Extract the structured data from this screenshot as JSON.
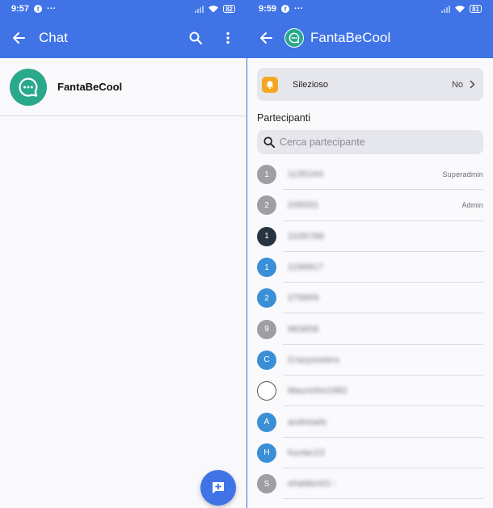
{
  "left": {
    "status": {
      "time": "9:57",
      "dots": "···",
      "battery": "82"
    },
    "header": {
      "title": "Chat"
    },
    "chats": [
      {
        "name": "FantaBeCool"
      }
    ]
  },
  "right": {
    "status": {
      "time": "9:59",
      "dots": "···",
      "battery": "81"
    },
    "header": {
      "title": "FantaBeCool"
    },
    "silent": {
      "label": "Silezioso",
      "value": "No"
    },
    "participants_title": "Partecipanti",
    "search": {
      "placeholder": "Cerca partecipante",
      "value": ""
    },
    "participants": [
      {
        "initial": "1",
        "name": "1135244",
        "role": "Superadmin",
        "color": "#9e9ea3",
        "outline": false
      },
      {
        "initial": "2",
        "name": "249331",
        "role": "Admin",
        "color": "#9e9ea3",
        "outline": false
      },
      {
        "initial": "1",
        "name": "1035766",
        "role": "",
        "color": "#263342",
        "outline": false
      },
      {
        "initial": "1",
        "name": "1196817",
        "role": "",
        "color": "#3a8fd6",
        "outline": false
      },
      {
        "initial": "2",
        "name": "279959",
        "role": "",
        "color": "#3a8fd6",
        "outline": false
      },
      {
        "initial": "9",
        "name": "983656",
        "role": "",
        "color": "#9e9ea3",
        "outline": false
      },
      {
        "initial": "C",
        "name": "Crazysisters",
        "role": "",
        "color": "#3a8fd6",
        "outline": false
      },
      {
        "initial": "",
        "name": "Maurinho1982",
        "role": "",
        "color": "#ffffff",
        "outline": true
      },
      {
        "initial": "A",
        "name": "andreads",
        "role": "",
        "color": "#3a8fd6",
        "outline": false
      },
      {
        "initial": "H",
        "name": "hunter23",
        "role": "",
        "color": "#3a8fd6",
        "outline": false
      },
      {
        "initial": "S",
        "name": "shaldon01~",
        "role": "",
        "color": "#9e9ea3",
        "outline": false
      }
    ]
  },
  "icons": {
    "back": "arrow-left-icon",
    "search": "search-icon",
    "more": "more-vert-icon",
    "chat": "chat-bubble-icon",
    "bell": "bell-icon",
    "chevron": "chevron-right-icon",
    "fab": "add-chat-icon"
  },
  "colors": {
    "accent": "#3f73e6",
    "group": "#2aa88b",
    "bell": "#f5a623"
  }
}
